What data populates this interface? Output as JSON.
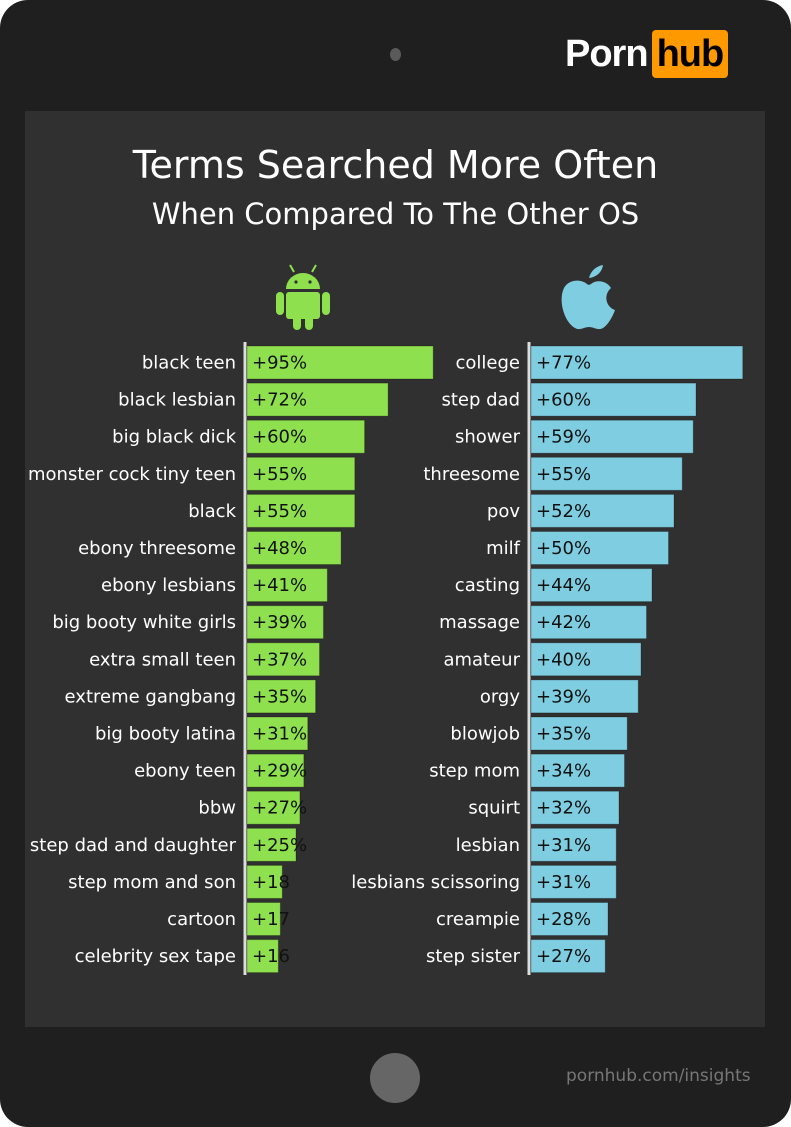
{
  "brand": {
    "word1": "Porn",
    "word2": "hub",
    "accent_color": "#ff9900"
  },
  "footer": {
    "url": "pornhub.com/insights"
  },
  "chart_data": {
    "type": "bar",
    "orientation": "horizontal",
    "title": "Terms Searched More Often",
    "subtitle": "When Compared To The Other OS",
    "panels": [
      {
        "name": "Android",
        "icon": "android-icon",
        "color": "#8fe04e",
        "categories": [
          "black teen",
          "black lesbian",
          "big black dick",
          "monster cock tiny teen",
          "black",
          "ebony threesome",
          "ebony lesbians",
          "big booty white girls",
          "extra small teen",
          "extreme gangbang",
          "big booty latina",
          "ebony teen",
          "bbw",
          "step dad and daughter",
          "step mom and son",
          "cartoon",
          "celebrity sex tape"
        ],
        "values": [
          95,
          72,
          60,
          55,
          55,
          48,
          41,
          39,
          37,
          35,
          31,
          29,
          27,
          25,
          18,
          17,
          16
        ],
        "labels": [
          "+95%",
          "+72%",
          "+60%",
          "+55%",
          "+55%",
          "+48%",
          "+41%",
          "+39%",
          "+37%",
          "+35%",
          "+31%",
          "+29%",
          "+27%",
          "+25%",
          "+18",
          "+17",
          "+16"
        ]
      },
      {
        "name": "iOS",
        "icon": "apple-icon",
        "color": "#7fcde0",
        "categories": [
          "college",
          "step dad",
          "shower",
          "threesome",
          "pov",
          "milf",
          "casting",
          "massage",
          "amateur",
          "orgy",
          "blowjob",
          "step mom",
          "squirt",
          "lesbian",
          "lesbians scissoring",
          "creampie",
          "step sister"
        ],
        "values": [
          77,
          60,
          59,
          55,
          52,
          50,
          44,
          42,
          40,
          39,
          35,
          34,
          32,
          31,
          31,
          28,
          27
        ],
        "labels": [
          "+77%",
          "+60%",
          "+59%",
          "+55%",
          "+52%",
          "+50%",
          "+44%",
          "+42%",
          "+40%",
          "+39%",
          "+35%",
          "+34%",
          "+32%",
          "+31%",
          "+31%",
          "+28%",
          "+27%"
        ]
      }
    ],
    "xlabel": "",
    "ylabel": "",
    "grid": false,
    "legend": "none"
  }
}
